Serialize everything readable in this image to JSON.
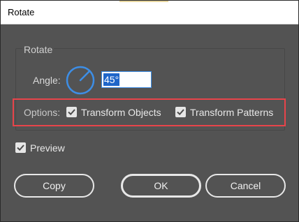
{
  "window": {
    "title": "Rotate"
  },
  "rotate_group": {
    "label": "Rotate",
    "angle_label": "Angle:",
    "angle_value": "45°"
  },
  "options": {
    "label": "Options:",
    "transform_objects": {
      "label": "Transform Objects",
      "checked": true
    },
    "transform_patterns": {
      "label": "Transform Patterns",
      "checked": true
    }
  },
  "preview": {
    "label": "Preview",
    "checked": true
  },
  "buttons": {
    "copy": "Copy",
    "ok": "OK",
    "cancel": "Cancel"
  },
  "colors": {
    "dialog_bg": "#535353",
    "dial_accent": "#3d8ee6",
    "highlight_border": "#e8444a",
    "selection": "#1f66c9"
  },
  "icons": {
    "dial": "angle-dial-icon",
    "checkmark": "checkmark-icon"
  }
}
